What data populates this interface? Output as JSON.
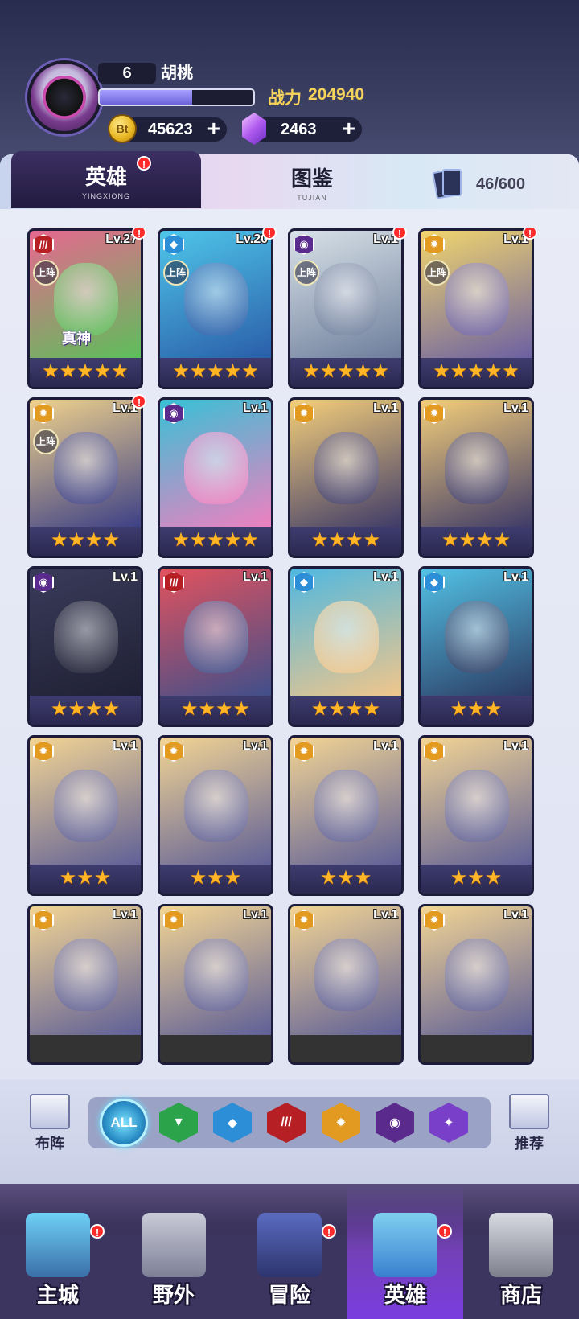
{
  "player": {
    "level": "6",
    "name": "胡桃",
    "exp_fraction": 0.6,
    "power_label": "战力",
    "power_value": "204940"
  },
  "currency": {
    "coins": "45623",
    "coin_symbol": "Bt",
    "gems": "2463",
    "plus": "+"
  },
  "tabs": [
    {
      "label": "英雄",
      "sub": "YINGXIONG",
      "active": true,
      "badge": "!"
    },
    {
      "label": "图鉴",
      "sub": "TUJIAN",
      "active": false
    }
  ],
  "collection": "46/600",
  "heroes": [
    {
      "level": "Lv.27",
      "stars": "★★★★★",
      "element": "claw",
      "deployed": true,
      "badge": true,
      "true_god": "真神"
    },
    {
      "level": "Lv.20",
      "stars": "★★★★★",
      "element": "water",
      "deployed": true,
      "badge": true
    },
    {
      "level": "Lv.1",
      "stars": "★★★★★",
      "element": "dark",
      "deployed": true,
      "badge": true
    },
    {
      "level": "Lv.1",
      "stars": "★★★★★",
      "element": "light",
      "deployed": true,
      "badge": true
    },
    {
      "level": "Lv.1",
      "stars": "★★★★",
      "element": "light",
      "deployed": true,
      "badge": true
    },
    {
      "level": "Lv.1",
      "stars": "★★★★★",
      "element": "dark",
      "deployed": false,
      "badge": false
    },
    {
      "level": "Lv.1",
      "stars": "★★★★",
      "element": "light",
      "deployed": false,
      "badge": false
    },
    {
      "level": "Lv.1",
      "stars": "★★★★",
      "element": "light",
      "deployed": false,
      "badge": false
    },
    {
      "level": "Lv.1",
      "stars": "★★★★",
      "element": "dark",
      "deployed": false,
      "badge": false
    },
    {
      "level": "Lv.1",
      "stars": "★★★★",
      "element": "claw",
      "deployed": false,
      "badge": false
    },
    {
      "level": "Lv.1",
      "stars": "★★★★",
      "element": "water",
      "deployed": false,
      "badge": false
    },
    {
      "level": "Lv.1",
      "stars": "★★★",
      "element": "water",
      "deployed": false,
      "badge": false
    },
    {
      "level": "Lv.1",
      "stars": "★★★",
      "element": "light",
      "deployed": false,
      "badge": false
    },
    {
      "level": "Lv.1",
      "stars": "★★★",
      "element": "light",
      "deployed": false,
      "badge": false
    },
    {
      "level": "Lv.1",
      "stars": "★★★",
      "element": "light",
      "deployed": false,
      "badge": false
    },
    {
      "level": "Lv.1",
      "stars": "★★★",
      "element": "light",
      "deployed": false,
      "badge": false
    },
    {
      "level": "Lv.1",
      "stars": "",
      "element": "light",
      "deployed": false,
      "badge": false
    },
    {
      "level": "Lv.1",
      "stars": "",
      "element": "light",
      "deployed": false,
      "badge": false
    },
    {
      "level": "Lv.1",
      "stars": "",
      "element": "light",
      "deployed": false,
      "badge": false
    },
    {
      "level": "Lv.1",
      "stars": "",
      "element": "light",
      "deployed": false,
      "badge": false
    }
  ],
  "deploy_label": "上阵",
  "filters": {
    "left_button": "布阵",
    "right_button": "推荐",
    "all_label": "ALL",
    "elements": [
      "nature-icon",
      "water-icon",
      "claw-icon",
      "light-icon",
      "dark-icon",
      "star-icon"
    ]
  },
  "bottom_nav": [
    {
      "label": "主城",
      "badge": true,
      "active": false
    },
    {
      "label": "野外",
      "badge": false,
      "active": false
    },
    {
      "label": "冒险",
      "badge": true,
      "active": false
    },
    {
      "label": "英雄",
      "badge": true,
      "active": true
    },
    {
      "label": "商店",
      "badge": false,
      "active": false
    }
  ],
  "colors": {
    "power": "#f6d35b",
    "tab_active": "#2d2450",
    "star": "#ffb524",
    "badge": "#ff2a2a",
    "element_claw": "#b61f24",
    "element_water": "#2c8ed6",
    "element_dark": "#5a2a8c",
    "element_light": "#e39a21",
    "element_nature": "#2aa34a",
    "element_star": "#7a3fc8"
  }
}
